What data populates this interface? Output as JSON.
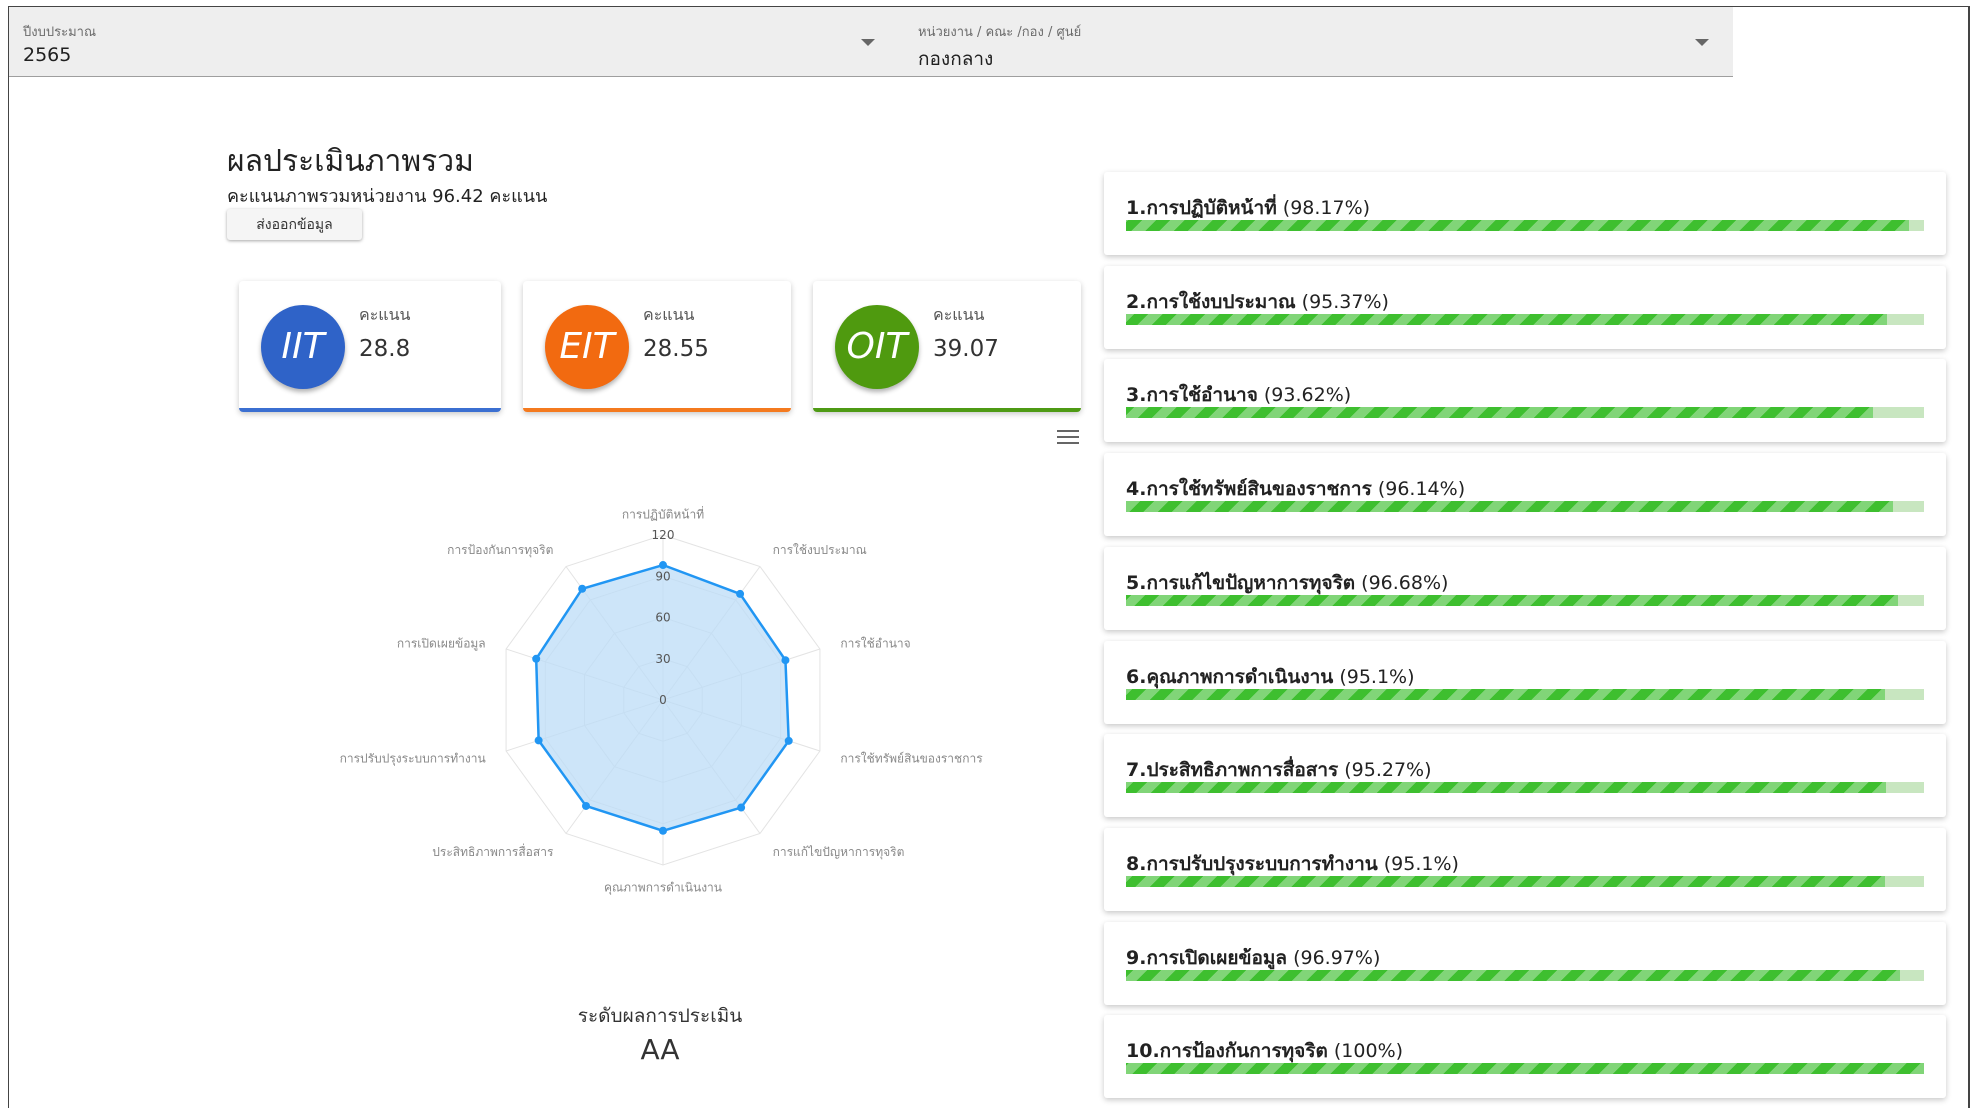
{
  "filters": {
    "year": {
      "label": "ปีงบประมาณ",
      "value": "2565"
    },
    "unit": {
      "label": "หน่วยงาน / คณะ /กอง / ศูนย์",
      "value": "กองกลาง"
    }
  },
  "overview": {
    "title": "ผลประเมินภาพรวม",
    "subtitle": "คะแนนภาพรวมหน่วยงาน 96.42 คะแนน",
    "export_label": "ส่งออกข้อมูล"
  },
  "score_cards": [
    {
      "code": "IIT",
      "label": "คะแนน",
      "value": "28.8",
      "color": "#2f63c8",
      "bar_color": "#3b6fd1"
    },
    {
      "code": "EIT",
      "label": "คะแนน",
      "value": "28.55",
      "color": "#f26a10",
      "bar_color": "#f47a1f"
    },
    {
      "code": "OIT",
      "label": "คะแนน",
      "value": "39.07",
      "color": "#4f9a0f",
      "bar_color": "#4e9a14"
    }
  ],
  "radar": {
    "ticks": [
      "0",
      "30",
      "60",
      "90",
      "120"
    ],
    "max": 120,
    "axes": [
      "การปฏิบัติหน้าที่",
      "การใช้งบประมาณ",
      "การใช้อำนาจ",
      "การใช้ทรัพย์สินของราชการ",
      "การแก้ไขปัญหาการทุจริต",
      "คุณภาพการดำเนินงาน",
      "ประสิทธิภาพการสื่อสาร",
      "การปรับปรุงระบบการทำงาน",
      "การเปิดเผยข้อมูล",
      "การป้องกันการทุจริต"
    ],
    "values": [
      98.17,
      95.37,
      93.62,
      96.14,
      96.68,
      95.1,
      95.27,
      95.1,
      96.97,
      100
    ],
    "line_color": "#2196f3",
    "fill_color": "#bcdcf7"
  },
  "assessment": {
    "label": "ระดับผลการประเมิน",
    "value": "AA"
  },
  "criteria": [
    {
      "name": "1.การปฏิบัติหน้าที่",
      "percent_text": "(98.17%)",
      "percent": 98.17
    },
    {
      "name": "2.การใช้งบประมาณ",
      "percent_text": "(95.37%)",
      "percent": 95.37
    },
    {
      "name": "3.การใช้อำนาจ",
      "percent_text": "(93.62%)",
      "percent": 93.62
    },
    {
      "name": "4.การใช้ทรัพย์สินของราชการ",
      "percent_text": "(96.14%)",
      "percent": 96.14
    },
    {
      "name": "5.การแก้ไขปัญหาการทุจริต",
      "percent_text": "(96.68%)",
      "percent": 96.68
    },
    {
      "name": "6.คุณภาพการดำเนินงาน",
      "percent_text": "(95.1%)",
      "percent": 95.1
    },
    {
      "name": "7.ประสิทธิภาพการสื่อสาร",
      "percent_text": "(95.27%)",
      "percent": 95.27
    },
    {
      "name": "8.การปรับปรุงระบบการทำงาน",
      "percent_text": "(95.1%)",
      "percent": 95.1
    },
    {
      "name": "9.การเปิดเผยข้อมูล",
      "percent_text": "(96.97%)",
      "percent": 96.97
    },
    {
      "name": "10.การป้องกันการทุจริต",
      "percent_text": "(100%)",
      "percent": 100
    }
  ]
}
